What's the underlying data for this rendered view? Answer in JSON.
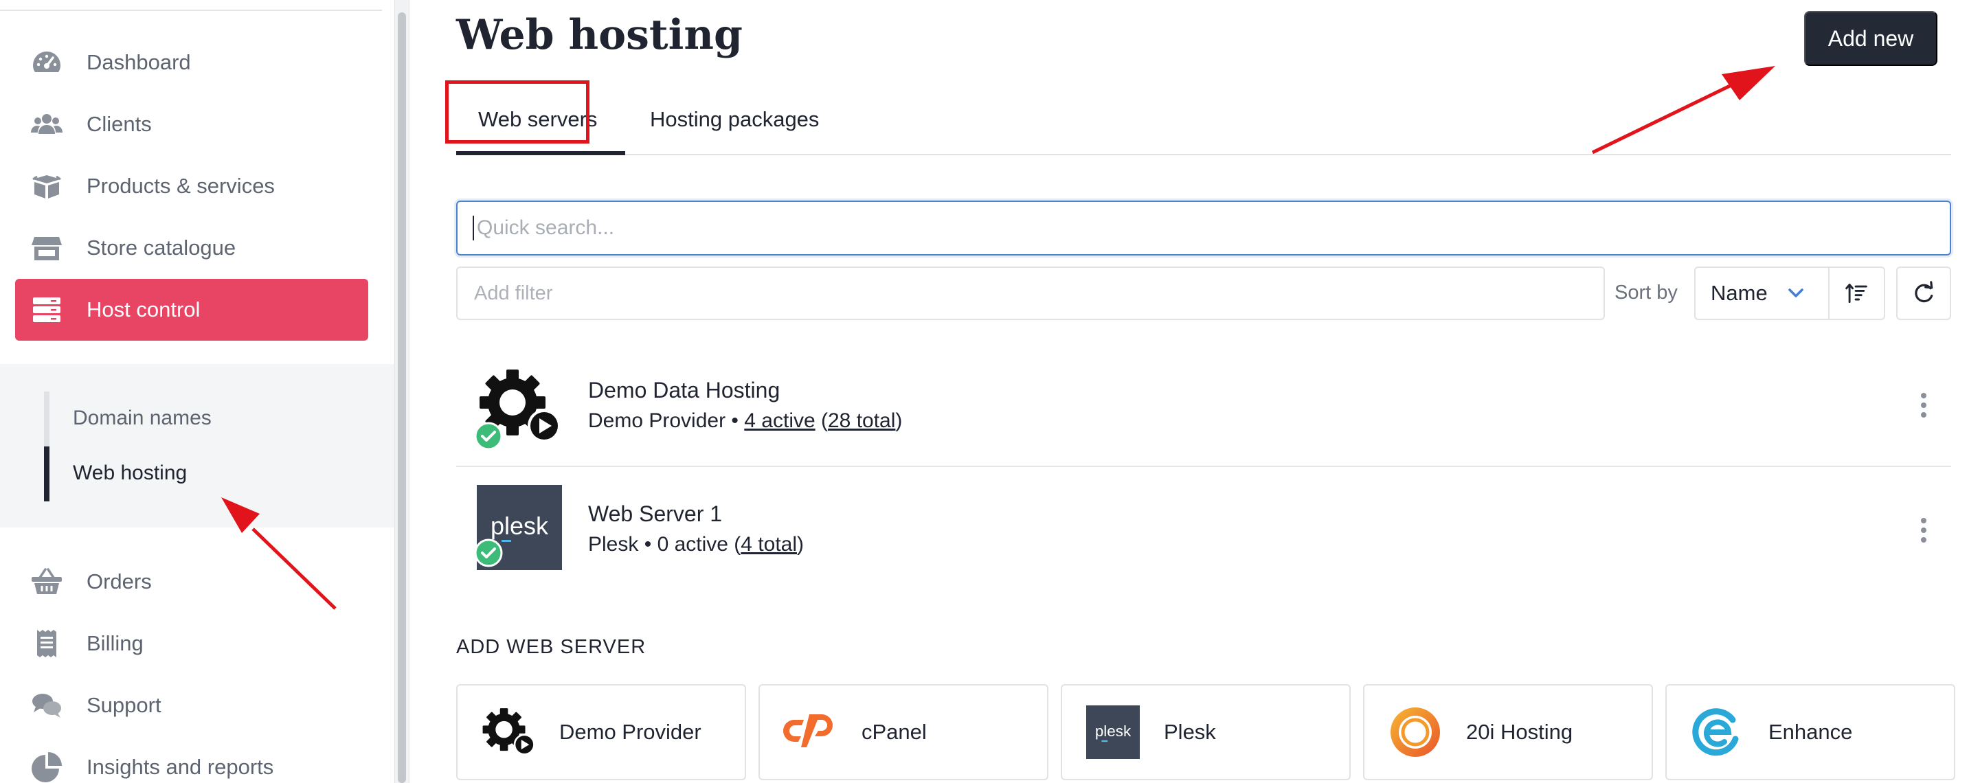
{
  "sidebar": {
    "items": [
      {
        "label": "Dashboard",
        "icon": "dashboard-icon"
      },
      {
        "label": "Clients",
        "icon": "clients-icon"
      },
      {
        "label": "Products & services",
        "icon": "products-icon"
      },
      {
        "label": "Store catalogue",
        "icon": "store-icon"
      },
      {
        "label": "Host control",
        "icon": "server-icon",
        "active": true
      },
      {
        "label": "Orders",
        "icon": "basket-icon"
      },
      {
        "label": "Billing",
        "icon": "receipt-icon"
      },
      {
        "label": "Support",
        "icon": "chat-icon"
      },
      {
        "label": "Insights and reports",
        "icon": "pie-chart-icon"
      }
    ],
    "subitems": [
      {
        "label": "Domain names"
      },
      {
        "label": "Web hosting",
        "active": true
      }
    ]
  },
  "header": {
    "title": "Web hosting",
    "add_button": "Add new"
  },
  "tabs": [
    {
      "label": "Web servers",
      "active": true
    },
    {
      "label": "Hosting packages"
    }
  ],
  "search": {
    "placeholder": "Quick search..."
  },
  "filter": {
    "placeholder": "Add filter"
  },
  "sort": {
    "label": "Sort by",
    "value": "Name"
  },
  "servers": [
    {
      "name": "Demo Data Hosting",
      "provider": "Demo Provider",
      "separator": "•",
      "active": "4 active",
      "total": "28 total",
      "logo": "gear-play-icon",
      "status": "ok"
    },
    {
      "name": "Web Server 1",
      "provider": "Plesk",
      "separator": "•",
      "active": "0 active",
      "total": "4 total",
      "logo": "plesk-logo",
      "logo_text": "plesk",
      "status": "ok"
    }
  ],
  "add_section": {
    "heading": "ADD WEB SERVER",
    "providers": [
      {
        "name": "Demo Provider",
        "icon": "gear-play-icon"
      },
      {
        "name": "cPanel",
        "icon": "cpanel-logo",
        "color": "#f26c2e"
      },
      {
        "name": "Plesk",
        "icon": "plesk-logo",
        "logo_text": "plesk",
        "color": "#3d4757"
      },
      {
        "name": "20i Hosting",
        "icon": "20i-logo",
        "color": "#f39a2b"
      },
      {
        "name": "Enhance",
        "icon": "enhance-logo",
        "color": "#2aa8d8"
      }
    ]
  },
  "colors": {
    "accent": "#e84565",
    "dark": "#232a35",
    "focus": "#4a82d4",
    "success": "#3dbb79",
    "annotation": "#e2141b"
  }
}
